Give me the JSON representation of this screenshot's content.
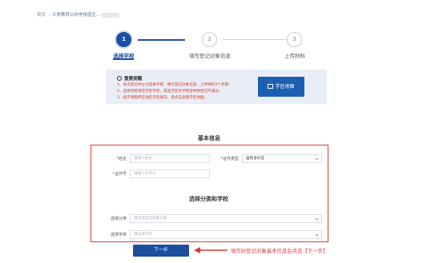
{
  "breadcrumb": {
    "home": "首页",
    "separator": "/",
    "current": "义务教育公办学校招生..."
  },
  "steps": [
    {
      "number": "1",
      "label": "选择学校",
      "state": "active"
    },
    {
      "number": "2",
      "label": "填写登记对象信息",
      "state": "inactive"
    },
    {
      "number": "3",
      "label": "上传材料",
      "state": "inactive"
    }
  ],
  "notice": {
    "title": "重要提醒",
    "lines": [
      "1、本次登记共分为选择学校、填写登记对象信息、上传材料3个步骤；",
      "2、选择学校请在学区学校，或选学区外学校会导致登记不通过；",
      "3、如不清楚所在地区学区情况，请点击查看学区地图。"
    ]
  },
  "map_button": {
    "label": "学区地图"
  },
  "basic_info": {
    "title": "基本信息",
    "name": {
      "label": "姓名",
      "required": "*",
      "placeholder": "请输入姓名"
    },
    "id_type": {
      "label": "证件类型",
      "required": "*",
      "value": "居民身份证"
    },
    "id_number": {
      "label": "证件号",
      "required": "*",
      "placeholder": "请输入证件号"
    }
  },
  "school_select": {
    "title": "选择分类和学校",
    "category": {
      "label": "选择分类",
      "placeholder": "请选择登记对象分类"
    },
    "school": {
      "label": "选择学校",
      "placeholder": "请选择学校"
    }
  },
  "next_button": {
    "label": "下一步"
  },
  "annotation": {
    "text": "填写好登记对象基本信息后点击【下一步】"
  },
  "colors": {
    "primary": "#1b4fa0",
    "alert": "#e03a3a",
    "notice_bg": "#e9eef6"
  }
}
